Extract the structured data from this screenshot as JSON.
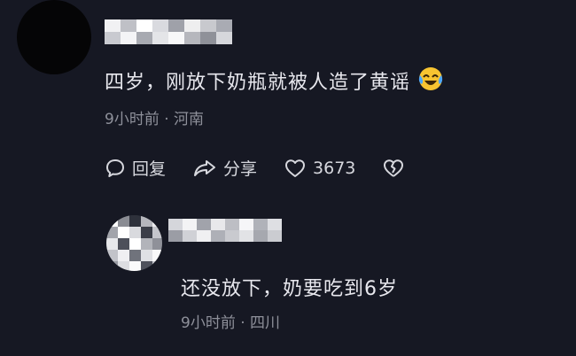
{
  "comment1": {
    "text": "四岁，刚放下奶瓶就被人造了黄谣",
    "emoji": "laughing-crying-emoji",
    "time": "9小时前",
    "location": "河南",
    "separator": "·",
    "actions": {
      "reply_label": "回复",
      "share_label": "分享",
      "like_count": "3673"
    }
  },
  "comment2": {
    "text": "还没放下，奶要吃到6岁",
    "time": "9小时前",
    "location": "四川",
    "separator": "·"
  },
  "colors": {
    "background": "#161823",
    "text": "#e8e8ee",
    "meta": "#8e909a",
    "icon": "#d7d8de"
  },
  "icons": [
    "comment-bubble-icon",
    "share-arrow-icon",
    "heart-icon",
    "broken-heart-icon",
    "laughing-crying-emoji"
  ]
}
